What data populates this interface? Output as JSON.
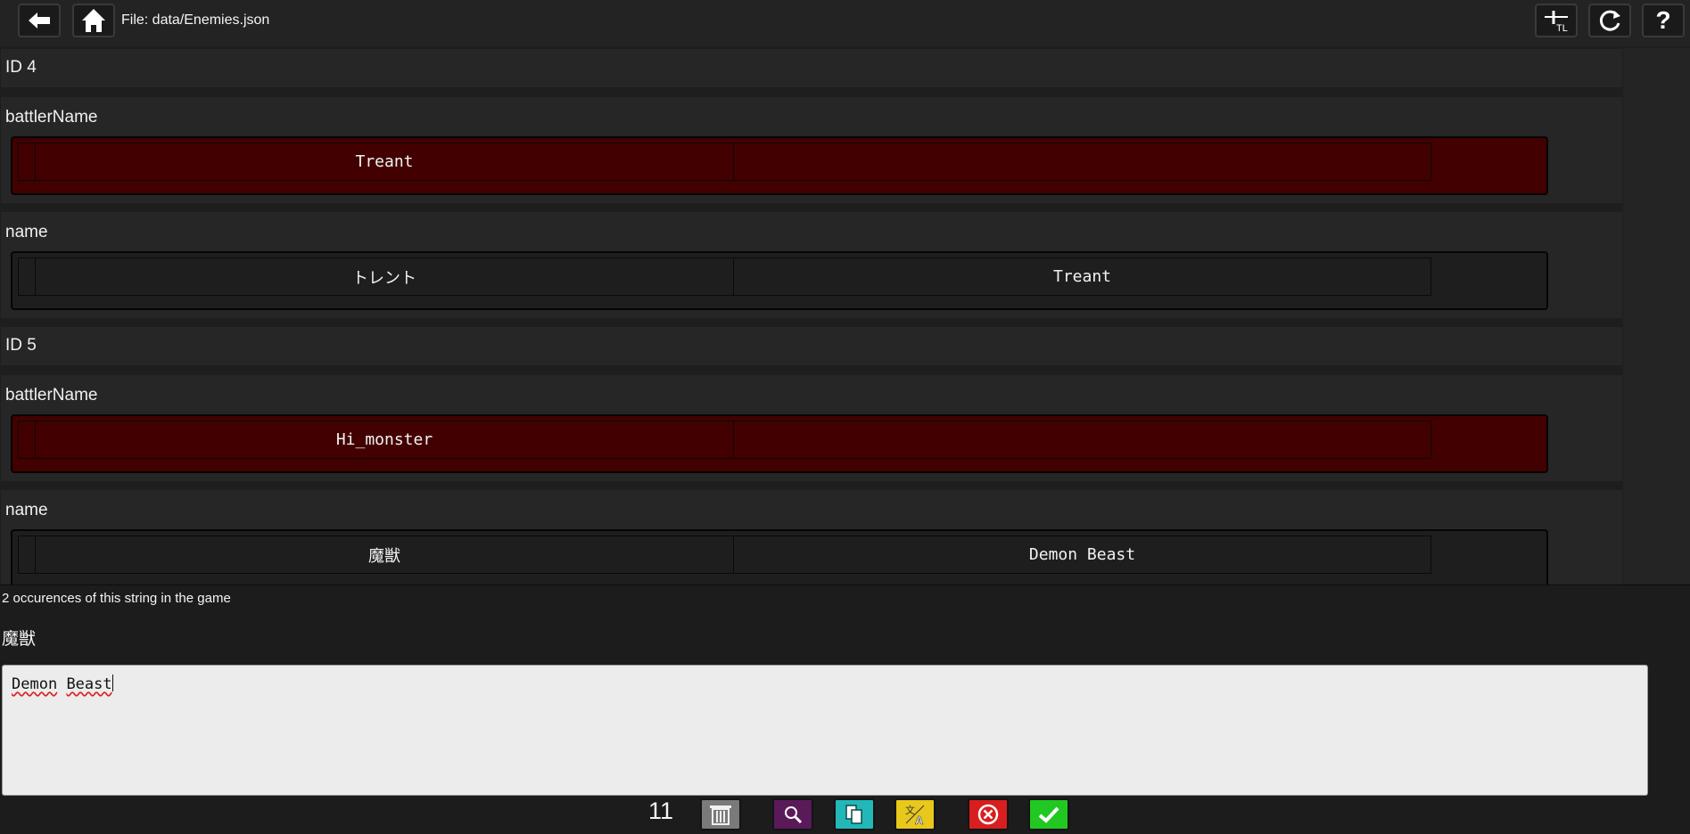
{
  "header": {
    "file_label": "File: data/Enemies.json",
    "icons": {
      "back": "arrow-left-icon",
      "home": "home-icon",
      "tl": "tl-marker-icon",
      "refresh": "refresh-icon",
      "help": "help-icon"
    },
    "help_glyph": "?",
    "tl_glyph": "TL"
  },
  "entries": [
    {
      "id_label": "ID 4"
    },
    {
      "field": "battlerName",
      "original": "Treant",
      "translation": "",
      "status": "untranslated"
    },
    {
      "field": "name",
      "original": "トレント",
      "translation": "Treant",
      "status": "translated"
    },
    {
      "id_label": "ID 5"
    },
    {
      "field": "battlerName",
      "original": "Hi_monster",
      "translation": "",
      "status": "untranslated"
    },
    {
      "field": "name",
      "original": "魔獣",
      "translation": "Demon Beast",
      "status": "translated"
    }
  ],
  "editor": {
    "occurrences_text": "2 occurences of this string in the game",
    "original_text": "魔獣",
    "translation_word1": "Demon",
    "translation_word2": "Beast"
  },
  "footer": {
    "count": "11",
    "buttons": [
      {
        "name": "trash-button",
        "icon": "trash-icon",
        "color": "#7a7a7a"
      },
      {
        "name": "search-button",
        "icon": "search-icon",
        "color": "#5a1a5a"
      },
      {
        "name": "copy-button",
        "icon": "copy-icon",
        "color": "#22b8b8"
      },
      {
        "name": "translate-button",
        "icon": "translate-icon",
        "color": "#e8c81a"
      },
      {
        "name": "cancel-button",
        "icon": "cancel-icon",
        "color": "#d81e1e"
      },
      {
        "name": "confirm-button",
        "icon": "check-icon",
        "color": "#22c822"
      }
    ]
  },
  "colors": {
    "untranslated_row": "#420000",
    "panel": "#262626",
    "background": "#1e1e1e"
  }
}
